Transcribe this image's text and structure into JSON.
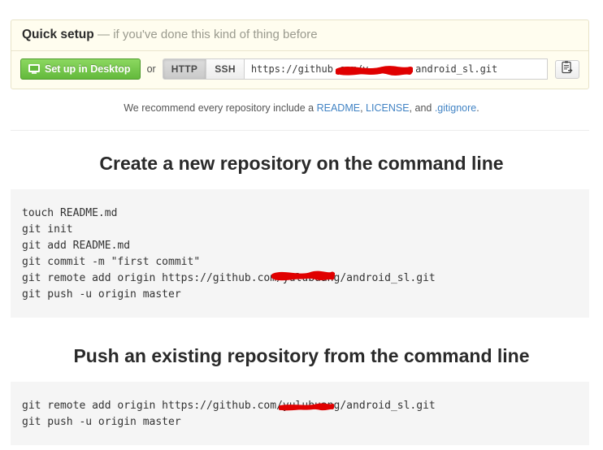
{
  "quick_setup": {
    "title": "Quick setup",
    "subtitle": "— if you've done this kind of thing before",
    "desktop_button": "Set up in Desktop",
    "desktop_icon": "desktop-monitor-icon",
    "or_label": "or",
    "protocols": [
      {
        "label": "HTTP",
        "selected": true
      },
      {
        "label": "SSH",
        "selected": false
      }
    ],
    "clone_url": "https://github.com/yulubuang/android_sl.git",
    "clone_url_display": "https://github.com/y████████android_sl.git",
    "copy_icon": "clipboard-copy-icon"
  },
  "recommend": {
    "prefix": "We recommend every repository include a ",
    "link_readme": "README",
    "sep1": ", ",
    "link_license": "LICENSE",
    "sep2": ", and ",
    "link_gitignore": ".gitignore",
    "suffix": "."
  },
  "sections": [
    {
      "title": "Create a new repository on the command line",
      "lines": [
        "touch README.md",
        "git init",
        "git add README.md",
        "git commit -m \"first commit\"",
        "git remote add origin https://github.com/yulubuang/android_sl.git",
        "git push -u origin master"
      ]
    },
    {
      "title": "Push an existing repository from the command line",
      "lines": [
        "git remote add origin https://github.com/yulubuang/android_sl.git",
        "git push -u origin master"
      ]
    }
  ],
  "colors": {
    "banner_bg": "#fffdef",
    "banner_border": "#e8e3c8",
    "button_green": "#6cc644",
    "link_blue": "#4183c4",
    "code_bg": "#f5f5f5",
    "redaction_red": "#e00000"
  },
  "annotations": {
    "redaction_note": "username redacted with red marker scribble",
    "count": 3
  }
}
